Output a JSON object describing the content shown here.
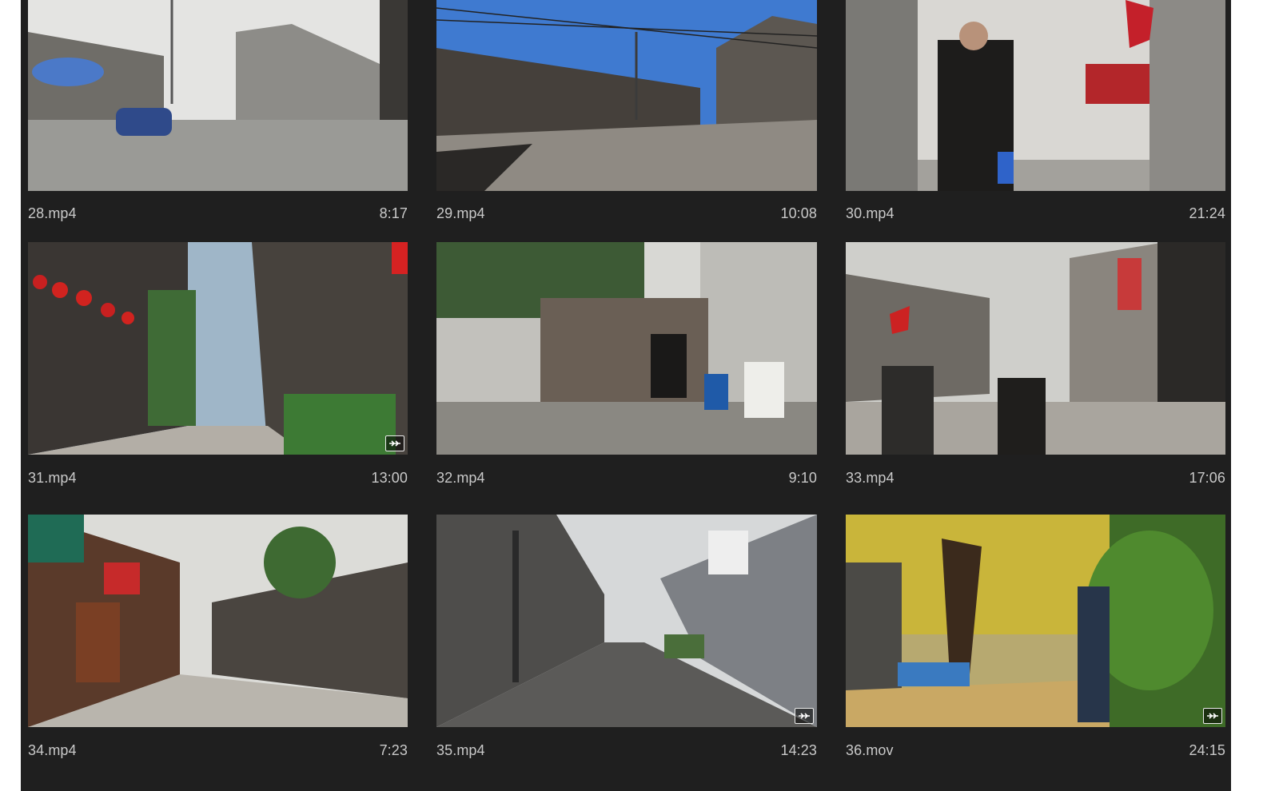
{
  "clips": [
    {
      "name": "28.mp4",
      "duration": "8:17",
      "badge": false
    },
    {
      "name": "29.mp4",
      "duration": "10:08",
      "badge": false
    },
    {
      "name": "30.mp4",
      "duration": "21:24",
      "badge": false
    },
    {
      "name": "31.mp4",
      "duration": "13:00",
      "badge": true
    },
    {
      "name": "32.mp4",
      "duration": "9:10",
      "badge": false
    },
    {
      "name": "33.mp4",
      "duration": "17:06",
      "badge": false
    },
    {
      "name": "34.mp4",
      "duration": "7:23",
      "badge": false
    },
    {
      "name": "35.mp4",
      "duration": "14:23",
      "badge": true
    },
    {
      "name": "36.mov",
      "duration": "24:15",
      "badge": true
    }
  ],
  "badge_icon": "speed-ramp-icon",
  "colors": {
    "panel": "#1f1f1f",
    "caption_text": "#c9c9c9"
  }
}
